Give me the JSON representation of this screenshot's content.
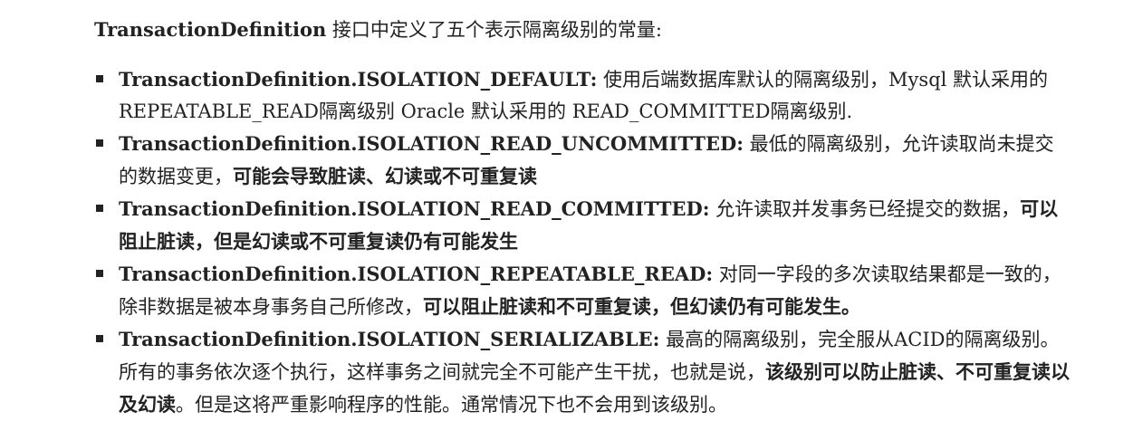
{
  "intro": {
    "name": "TransactionDefinition",
    "text": " 接口中定义了五个表示隔离级别的常量:"
  },
  "items": [
    {
      "constant": "TransactionDefinition.ISOLATION_DEFAULT:",
      "text": " 使用后端数据库默认的隔离级别，Mysql 默认采用的 REPEATABLE_READ隔离级别 Oracle 默认采用的 READ_COMMITTED隔离级别.",
      "bold_tail": "",
      "tail": ""
    },
    {
      "constant": "TransactionDefinition.ISOLATION_READ_UNCOMMITTED:",
      "text": " 最低的隔离级别，允许读取尚未提交的数据变更，",
      "bold_tail": "可能会导致脏读、幻读或不可重复读",
      "tail": ""
    },
    {
      "constant": "TransactionDefinition.ISOLATION_READ_COMMITTED:",
      "text": " 允许读取并发事务已经提交的数据，",
      "bold_tail": "可以阻止脏读，但是幻读或不可重复读仍有可能发生",
      "tail": ""
    },
    {
      "constant": "TransactionDefinition.ISOLATION_REPEATABLE_READ:",
      "text": " 对同一字段的多次读取结果都是一致的，除非数据是被本身事务自己所修改，",
      "bold_tail": "可以阻止脏读和不可重复读，但幻读仍有可能发生。",
      "tail": ""
    },
    {
      "constant": "TransactionDefinition.ISOLATION_SERIALIZABLE:",
      "text": " 最高的隔离级别，完全服从ACID的隔离级别。所有的事务依次逐个执行，这样事务之间就完全不可能产生干扰，也就是说，",
      "bold_tail": "该级别可以防止脏读、不可重复读以及幻读",
      "tail": "。但是这将严重影响程序的性能。通常情况下也不会用到该级别。"
    }
  ]
}
